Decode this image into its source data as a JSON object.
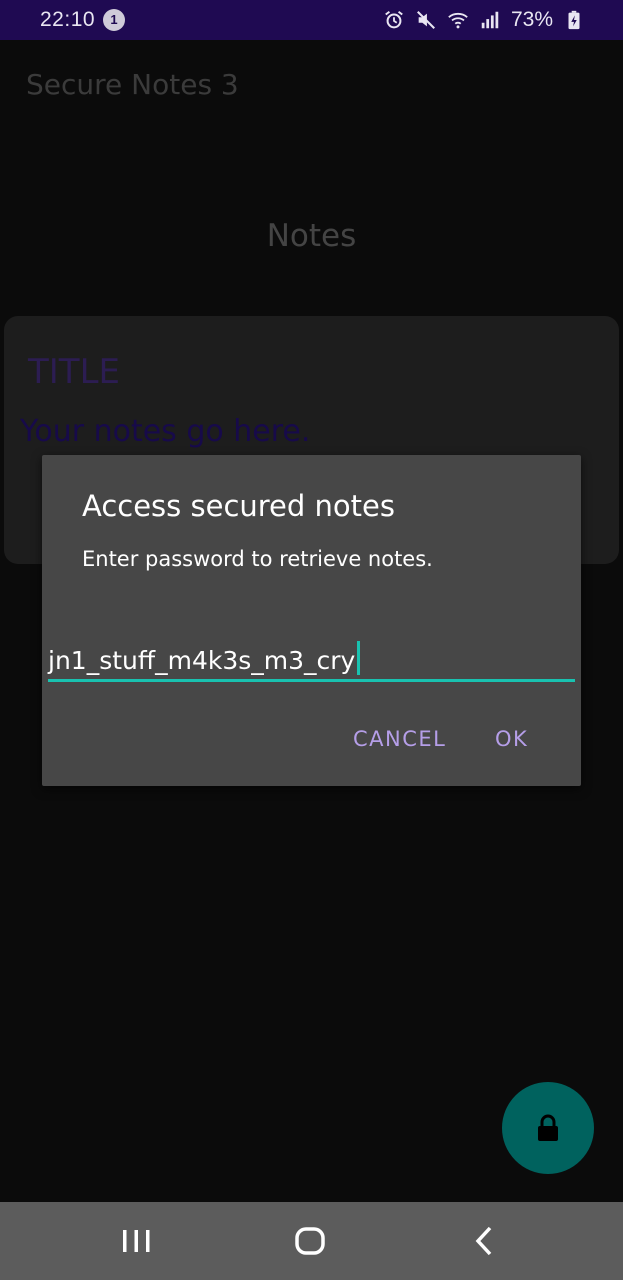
{
  "status_bar": {
    "time": "22:10",
    "notification_count": "1",
    "battery": "73%",
    "icons": [
      "alarm-icon",
      "mute-icon",
      "wifi-icon",
      "signal-icon",
      "battery-charging-icon"
    ]
  },
  "app_bar": {
    "title": "Secure Notes 3"
  },
  "main": {
    "heading": "Notes",
    "note_card": {
      "title": "TITLE",
      "body": "Your notes go here."
    }
  },
  "dialog": {
    "title": "Access secured notes",
    "message": "Enter password to retrieve notes.",
    "password_value": "jn1_stuff_m4k3s_m3_cry",
    "cancel_label": "CANCEL",
    "ok_label": "OK"
  },
  "fab": {
    "icon": "lock-icon"
  },
  "nav_bar": {
    "icons": [
      "recents-icon",
      "home-icon",
      "back-icon"
    ]
  },
  "colors": {
    "status_bar": "#1f0a52",
    "background": "#0b0b0b",
    "dialog": "#474747",
    "accent": "#19c2b0",
    "button_text": "#b59ee8",
    "fab": "#00625e",
    "nav_bar": "#5c5c5c"
  }
}
